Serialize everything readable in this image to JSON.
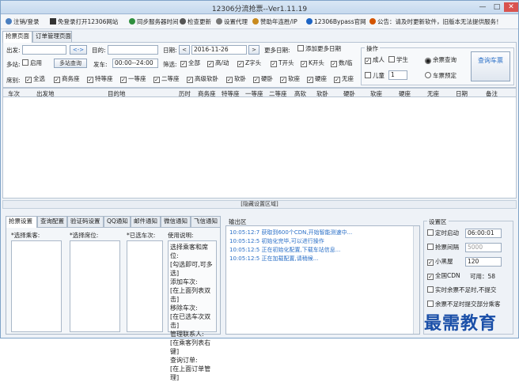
{
  "window": {
    "title": "12306分流抢票--Ver1.11.19",
    "minimize": "—",
    "maximize": "□",
    "close": "✕"
  },
  "toolbar": [
    {
      "icon": "logout-icon",
      "label": "注销/登录"
    },
    {
      "icon": "forward-icon",
      "label": "免登录打开12306网站"
    },
    {
      "icon": "sync-icon",
      "label": "同步服务器时间"
    },
    {
      "icon": "download-icon",
      "label": "检查更新"
    },
    {
      "icon": "gear-icon",
      "label": "设置代理"
    },
    {
      "icon": "donate-icon",
      "label": "赞助年连胜/IP"
    },
    {
      "icon": "link-icon",
      "label": "12306Bypass官网"
    },
    {
      "icon": "speaker-icon",
      "label": "公告：请及时更新软件，旧版本无法提供服务！"
    }
  ],
  "main_tabs": [
    "抢票页面",
    "订单管理页面"
  ],
  "form": {
    "from_label": "出发:",
    "from_value": "",
    "swap": "<->",
    "to_label": "目的:",
    "to_value": "",
    "date_label": "日期:",
    "date_value": "2016-11-26",
    "prev": "<",
    "next": ">",
    "more_dates_label": "更多日期:",
    "add_more_dates": "添加更多日期",
    "multi_label": "多站:",
    "enable": "启用",
    "multi_query": "多站查询",
    "depart_label": "发车:",
    "depart_value": "00:00--24:00",
    "filter_label": "筛选:",
    "filter_options": [
      "全部",
      "高/动",
      "Z字头",
      "T开头",
      "K开头",
      "数/临"
    ],
    "seat_label": "席别:",
    "seat_options": [
      "全选",
      "商务座",
      "特等座",
      "一等座",
      "二等座",
      "高级软卧",
      "软卧",
      "硬卧",
      "软座",
      "硬座",
      "无座"
    ]
  },
  "ops": {
    "title": "操作",
    "adult": "成人",
    "student": "学生",
    "child": "儿童",
    "child_count": "1",
    "query_tickets": "余票查询",
    "query_fare": "车票预定",
    "query_button": "查询车票"
  },
  "grid_columns": [
    "车次",
    "出发地",
    "目的地",
    "历时",
    "商务座",
    "特等座",
    "一等座",
    "二等座",
    "高软",
    "软卧",
    "硬卧",
    "软座",
    "硬座",
    "无座",
    "日期",
    "备注"
  ],
  "hide_bar": "[隐藏设置区域]",
  "bottom_tabs": [
    "抢票设置",
    "查询配置",
    "验证码设置",
    "QQ通知",
    "邮件通知",
    "微信通知",
    "飞信通知"
  ],
  "lists": {
    "passengers": "*选择乘客:",
    "seats": "*选择席位:",
    "trains": "*已选车次:"
  },
  "usage": {
    "title": "使用说明:",
    "lines": [
      "选择乘客和席位:",
      "[勾选即可,可多选]",
      "添加车次:",
      "[在上面列表双击]",
      "移除车次:",
      "[在已选车次双击]",
      "管理联系人:",
      "[在乘客列表右键]",
      "查询订单:",
      "[在上面订单管理]"
    ]
  },
  "log": {
    "title": "输出区",
    "lines": [
      "10:05:12:7  获取到600个CDN,开始智能测速中...",
      "10:05:12:5  初始化完毕,可以进行操作",
      "10:05:12:5  正在初始化配置,下载车站信息...",
      "10:05:12:5  正在加载配置,请稍候..."
    ]
  },
  "settings": {
    "title": "设置区",
    "timed_label": "定时启动",
    "timed_value": "06:00:01",
    "interval_label": "抢票间隔",
    "interval_value": "5000",
    "blackroom_label": "小黑屋",
    "blackroom_value": "120",
    "cdn_label": "全国CDN",
    "cdn_info": "可用：58",
    "auto_submit": "实时余票不足时,不提交",
    "partial_submit": "余票不足时提交部分乘客"
  },
  "watermark": "最需教育"
}
